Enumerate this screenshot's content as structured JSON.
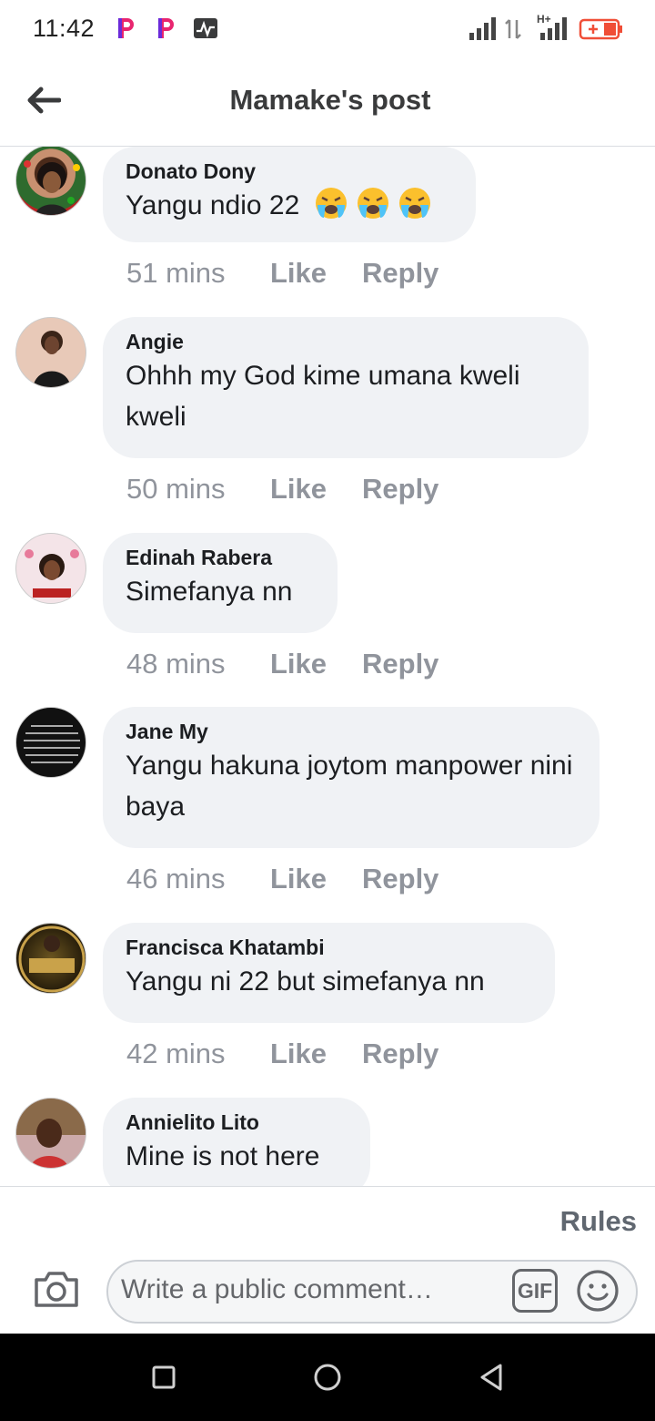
{
  "status_bar": {
    "time": "11:42",
    "notification_icons": [
      "p-app-icon",
      "p-app-icon",
      "activity-chart-icon"
    ],
    "right_icons": [
      "signal-icon",
      "data-transfer-icon",
      "signal-hplus-icon",
      "battery-charging-icon"
    ],
    "network_label": "H+"
  },
  "header": {
    "title": "Mamake's post",
    "back_icon": "back-arrow-icon"
  },
  "comments": [
    {
      "author": "Donato Dony",
      "text": "Yangu ndio 22",
      "emoji": [
        "loudly-crying-face",
        "loudly-crying-face",
        "loudly-crying-face"
      ],
      "time": "51 mins",
      "like": "Like",
      "reply": "Reply"
    },
    {
      "author": "Angie",
      "text": "Ohhh my God kime umana kweli kweli",
      "time": "50 mins",
      "like": "Like",
      "reply": "Reply"
    },
    {
      "author": "Edinah Rabera",
      "text": "Simefanya nn",
      "time": "48 mins",
      "like": "Like",
      "reply": "Reply"
    },
    {
      "author": "Jane My",
      "text": "Yangu hakuna joytom manpower nini baya",
      "time": "46 mins",
      "like": "Like",
      "reply": "Reply"
    },
    {
      "author": "Francisca Khatambi",
      "text": "Yangu ni 22 but simefanya nn",
      "time": "42 mins",
      "like": "Like",
      "reply": "Reply"
    },
    {
      "author": "Annielito Lito",
      "text": "Mine is not here"
    }
  ],
  "footer": {
    "rules_label": "Rules",
    "composer_placeholder": "Write a public comment…",
    "gif_label": "GIF",
    "camera_icon": "camera-icon",
    "emoji_icon": "smiley-icon"
  },
  "navbar": {
    "icons": [
      "recents-square-icon",
      "home-circle-icon",
      "back-triangle-icon"
    ]
  },
  "colors": {
    "bubble": "#f0f2f5",
    "meta_text": "#90949c",
    "notif_accent": "#e8256f",
    "battery": "#f04e37"
  }
}
